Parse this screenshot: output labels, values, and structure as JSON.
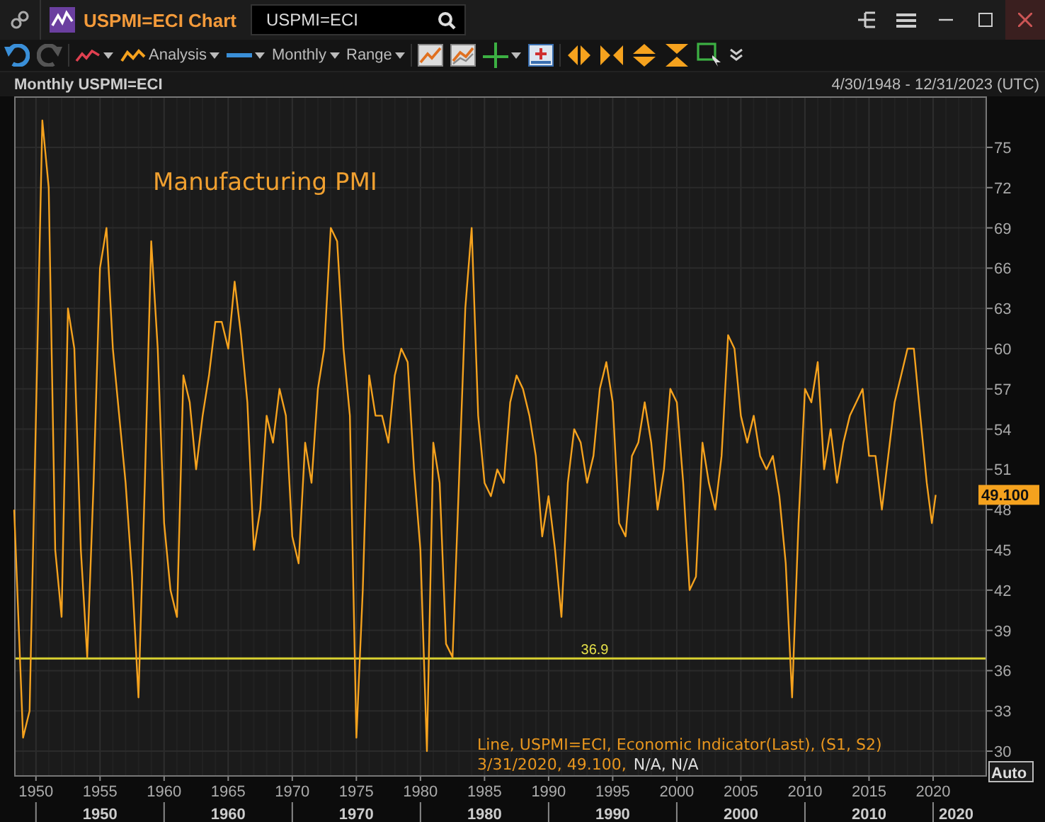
{
  "window": {
    "title": "USPMI=ECI Chart",
    "search": {
      "value": "USPMI=ECI"
    }
  },
  "toolbar": {
    "analysis": "Analysis",
    "interval": "Monthly",
    "range": "Range"
  },
  "chart_header": {
    "title": "Monthly USPMI=ECI",
    "date_range": "4/30/1948 - 12/31/2023 (UTC)"
  },
  "chart": {
    "annotation": "Manufacturing PMI",
    "last_value": "49.100",
    "auto_button": "Auto",
    "legend": {
      "line1": "Line, USPMI=ECI, Economic Indicator(Last), (S1, S2)",
      "line2": "3/31/2020, 49.100,",
      "line2_extra": "N/A, N/A"
    },
    "decades": [
      "1950",
      "1960",
      "1970",
      "1980",
      "1990",
      "2000",
      "2010",
      "2020"
    ],
    "chart_data": {
      "type": "line",
      "xlim": [
        1948.3,
        2024.2
      ],
      "ylim": [
        28.1,
        78.8
      ],
      "xticks": [
        1950,
        1955,
        1960,
        1965,
        1970,
        1975,
        1980,
        1985,
        1990,
        1995,
        2000,
        2005,
        2010,
        2015,
        2020
      ],
      "yticks": [
        30,
        33,
        36,
        39,
        42,
        45,
        48,
        51,
        54,
        57,
        60,
        63,
        66,
        69,
        72,
        75
      ],
      "grid": true,
      "ref_lines": [
        {
          "axis": "y",
          "value": 36.9,
          "label": "36.9",
          "color": "#d8d030"
        }
      ],
      "x": [
        1948.3,
        1949,
        1949.5,
        1950,
        1950.5,
        1951,
        1951.5,
        1952,
        1952.5,
        1953,
        1953.5,
        1954,
        1954.5,
        1955,
        1955.5,
        1956,
        1956.5,
        1957,
        1957.5,
        1958,
        1958.5,
        1959,
        1959.5,
        1960,
        1960.5,
        1961,
        1961.5,
        1962,
        1962.5,
        1963,
        1963.5,
        1964,
        1964.5,
        1965,
        1965.5,
        1966,
        1966.5,
        1967,
        1967.5,
        1968,
        1968.5,
        1969,
        1969.5,
        1970,
        1970.5,
        1971,
        1971.5,
        1972,
        1972.5,
        1973,
        1973.5,
        1974,
        1974.5,
        1975,
        1975.5,
        1976,
        1976.5,
        1977,
        1977.5,
        1978,
        1978.5,
        1979,
        1979.5,
        1980,
        1980.5,
        1981,
        1981.5,
        1982,
        1982.5,
        1983,
        1983.5,
        1984,
        1984.5,
        1985,
        1985.5,
        1986,
        1986.5,
        1987,
        1987.5,
        1988,
        1988.5,
        1989,
        1989.5,
        1990,
        1990.5,
        1991,
        1991.5,
        1992,
        1992.5,
        1993,
        1993.5,
        1994,
        1994.5,
        1995,
        1995.5,
        1996,
        1996.5,
        1997,
        1997.5,
        1998,
        1998.5,
        1999,
        1999.5,
        2000,
        2000.5,
        2001,
        2001.5,
        2002,
        2002.5,
        2003,
        2003.5,
        2004,
        2004.5,
        2005,
        2005.5,
        2006,
        2006.5,
        2007,
        2007.5,
        2008,
        2008.5,
        2009,
        2009.5,
        2010,
        2010.5,
        2011,
        2011.5,
        2012,
        2012.5,
        2013,
        2013.5,
        2014,
        2014.5,
        2015,
        2015.5,
        2016,
        2016.5,
        2017,
        2017.5,
        2018,
        2018.5,
        2019,
        2019.5,
        2019.9,
        2020.2
      ],
      "series": [
        {
          "color": "#f5a21e",
          "values": [
            48,
            31,
            33,
            55,
            77,
            72,
            45,
            40,
            63,
            60,
            45,
            37,
            50,
            66,
            69,
            60,
            55,
            50,
            43,
            34,
            50,
            68,
            60,
            47,
            42,
            40,
            58,
            56,
            51,
            55,
            58,
            62,
            62,
            60,
            65,
            61,
            56,
            45,
            48,
            55,
            53,
            57,
            55,
            46,
            44,
            53,
            50,
            57,
            60,
            69,
            68,
            60,
            55,
            31,
            42,
            58,
            55,
            55,
            53,
            58,
            60,
            59,
            51,
            45,
            30,
            53,
            50,
            38,
            37,
            50,
            63,
            69,
            55,
            50,
            49,
            51,
            50,
            56,
            58,
            57,
            55,
            52,
            46,
            49,
            45,
            40,
            50,
            54,
            53,
            50,
            52,
            57,
            59,
            56,
            47,
            46,
            52,
            53,
            56,
            53,
            48,
            51,
            57,
            56,
            50,
            42,
            43,
            53,
            50,
            48,
            52,
            61,
            60,
            55,
            53,
            55,
            52,
            51,
            52,
            49,
            44,
            34,
            47,
            57,
            56,
            59,
            51,
            54,
            50,
            53,
            55,
            56,
            57,
            52,
            52,
            48,
            52,
            56,
            58,
            60,
            60,
            55,
            50,
            47,
            49.1
          ]
        }
      ]
    }
  }
}
